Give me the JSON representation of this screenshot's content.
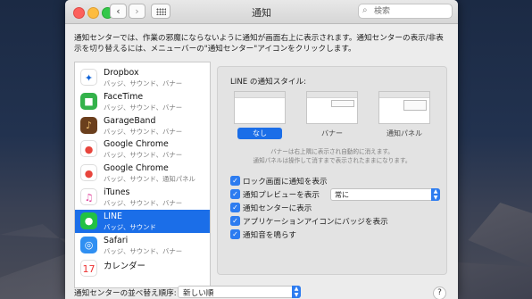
{
  "window": {
    "title": "通知"
  },
  "toolbar": {
    "back_glyph": "‹",
    "forward_glyph": "›",
    "search_placeholder": "検索",
    "search_icon": "magnifier-icon"
  },
  "description": "通知センターでは、作業の邪魔にならないように通知が画面右上に表示されます。通知センターの表示/非表示を切り替えるには、メニューバーの\"通知センター\"アイコンをクリックします。",
  "apps": [
    {
      "name": "Dropbox",
      "sub": "バッジ、サウンド、バナー",
      "icon": "dropbox-icon",
      "glyph": "✦",
      "bg": "#ffffff",
      "fg": "#0d62d8",
      "selected": false
    },
    {
      "name": "FaceTime",
      "sub": "バッジ、サウンド、バナー",
      "icon": "facetime-icon",
      "glyph": "■",
      "bg": "#33b24a",
      "fg": "#ffffff",
      "selected": false
    },
    {
      "name": "GarageBand",
      "sub": "バッジ、サウンド、バナー",
      "icon": "garageband-icon",
      "glyph": "♪",
      "bg": "#6b3f1d",
      "fg": "#f0c070",
      "selected": false
    },
    {
      "name": "Google Chrome",
      "sub": "バッジ、サウンド、バナー",
      "icon": "chrome-icon",
      "glyph": "●",
      "bg": "#ffffff",
      "fg": "#e8453c",
      "selected": false
    },
    {
      "name": "Google Chrome",
      "sub": "バッジ、サウンド、通知パネル",
      "icon": "chrome-icon",
      "glyph": "●",
      "bg": "#ffffff",
      "fg": "#e8453c",
      "selected": false
    },
    {
      "name": "iTunes",
      "sub": "バッジ、サウンド、バナー",
      "icon": "itunes-icon",
      "glyph": "♫",
      "bg": "#ffffff",
      "fg": "#e0409a",
      "selected": false
    },
    {
      "name": "LINE",
      "sub": "バッジ、サウンド",
      "icon": "line-icon",
      "glyph": "●",
      "bg": "#22c144",
      "fg": "#ffffff",
      "selected": true
    },
    {
      "name": "Safari",
      "sub": "バッジ、サウンド、バナー",
      "icon": "safari-icon",
      "glyph": "◎",
      "bg": "#2f8ff2",
      "fg": "#ffffff",
      "selected": false
    },
    {
      "name": "カレンダー",
      "sub": "",
      "icon": "calendar-icon",
      "glyph": "17",
      "bg": "#ffffff",
      "fg": "#e33",
      "selected": false
    }
  ],
  "detail": {
    "style_label": "LINE の通知スタイル:",
    "styles": [
      {
        "label": "なし",
        "selected": true
      },
      {
        "label": "バナー",
        "selected": false
      },
      {
        "label": "通知パネル",
        "selected": false
      }
    ],
    "note_line1": "バナーは右上隅に表示され自動的に消えます。",
    "note_line2": "通知パネルは操作して消すまで表示されたままになります。",
    "options": [
      {
        "label": "ロック画面に通知を表示",
        "checked": true
      },
      {
        "label": "通知プレビューを表示",
        "checked": true
      },
      {
        "label": "通知センターに表示",
        "checked": true
      },
      {
        "label": "アプリケーションアイコンにバッジを表示",
        "checked": true
      },
      {
        "label": "通知音を鳴らす",
        "checked": true
      }
    ],
    "preview_value": "常に"
  },
  "bottom": {
    "sort_label": "通知センターの並べ替え順序:",
    "sort_value": "新しい順",
    "help": "?"
  },
  "colors": {
    "accent": "#1b6ee8",
    "checkbox": "#2d7cf0"
  }
}
